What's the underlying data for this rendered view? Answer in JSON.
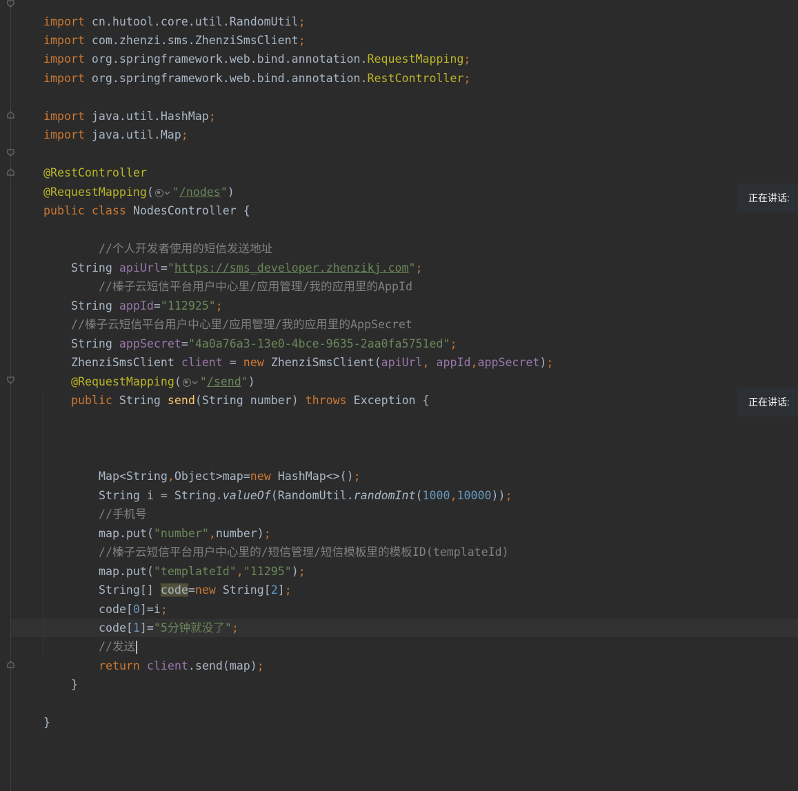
{
  "editor": {
    "lines": {
      "l1": {
        "kw": "import",
        "pkg": " cn.hutool.core.util.RandomUtil",
        "semi": ";"
      },
      "l2": {
        "kw": "import",
        "pkg": " com.zhenzi.sms.ZhenziSmsClient",
        "semi": ";"
      },
      "l3": {
        "kw": "import",
        "pkg": " org.springframework.web.bind.annotation.",
        "cls": "RequestMapping",
        "semi": ";"
      },
      "l4": {
        "kw": "import",
        "pkg": " org.springframework.web.bind.annotation.",
        "cls": "RestController",
        "semi": ";"
      },
      "l6": {
        "kw": "import",
        "pkg": " java.util.HashMap",
        "semi": ";"
      },
      "l7": {
        "kw": "import",
        "pkg": " java.util.Map",
        "semi": ";"
      },
      "l9": {
        "ann": "@RestController"
      },
      "l10": {
        "ann": "@RequestMapping",
        "open": "(",
        "q1": "\"",
        "path": "/nodes",
        "q2": "\"",
        "close": ")"
      },
      "l11": {
        "kw": "public class",
        "name": " NodesController {"
      },
      "l13": {
        "comment": "//个人开发者使用的短信发送地址"
      },
      "l14": {
        "type": "String ",
        "field": "apiUrl",
        "eq": "=",
        "q1": "\"",
        "url": "https://sms_developer.zhenzikj.com",
        "q2": "\"",
        "semi": ";"
      },
      "l15": {
        "comment": "//榛子云短信平台用户中心里/应用管理/我的应用里的AppId"
      },
      "l16": {
        "type": "String ",
        "field": "appId",
        "eq": "=",
        "str": "\"112925\"",
        "semi": ";"
      },
      "l17": {
        "comment": "//榛子云短信平台用户中心里/应用管理/我的应用里的AppSecret"
      },
      "l18": {
        "type": "String ",
        "field": "appSecret",
        "eq": "=",
        "str": "\"4a0a76a3-13e0-4bce-9635-2aa0fa5751ed\"",
        "semi": ";"
      },
      "l19": {
        "type": "ZhenziSmsClient ",
        "field": "client",
        "eq": " = ",
        "kw": "new",
        "ctor": " ZhenziSmsClient(",
        "a1": "apiUrl",
        "c1": ", ",
        "a2": "appId",
        "c2": ",",
        "a3": "appSecret",
        "close": ")",
        "semi": ";"
      },
      "l20": {
        "ann": "@RequestMapping",
        "open": "(",
        "q1": "\"",
        "path": "/send",
        "q2": "\"",
        "close": ")"
      },
      "l21": {
        "kw": "public",
        "type": " String ",
        "method": "send",
        "params": "(String number) ",
        "kw2": "throws",
        "rest": " Exception {"
      },
      "l25": {
        "type": "Map<String",
        "comma": ",",
        "type2": "Object>map=",
        "kw": "new",
        "rest": " HashMap<>()",
        "semi": ";"
      },
      "l26": {
        "pre": "String i = String.",
        "m1": "valueOf",
        "mid": "(RandomUtil.",
        "m2": "randomInt",
        "open": "(",
        "n1": "1000",
        "comma": ",",
        "n2": "10000",
        "close": "))",
        "semi": ";"
      },
      "l27": {
        "comment": "//手机号"
      },
      "l28": {
        "pre": "map.put(",
        "str": "\"number\"",
        "comma": ",",
        "rest": "number)",
        "semi": ";"
      },
      "l29": {
        "comment": "//榛子云短信平台用户中心里的/短信管理/短信模板里的模板ID(templateId)"
      },
      "l30": {
        "pre": "map.put(",
        "str1": "\"templateId\"",
        "comma": ",",
        "str2": "\"11295\"",
        "close": ")",
        "semi": ";"
      },
      "l31": {
        "pre": "String[] ",
        "var": "code",
        "eq": "=",
        "kw": "new",
        "mid": " String[",
        "num": "2",
        "close": "]",
        "semi": ";"
      },
      "l32": {
        "pre": "code[",
        "num": "0",
        "rest": "]=i",
        "semi": ";"
      },
      "l33": {
        "pre": "code[",
        "num": "1",
        "rest": "]=",
        "str": "\"5分钟就没了\"",
        "semi": ";"
      },
      "l34": {
        "comment": "//发送"
      },
      "l35": {
        "kw": "return",
        "sp": " ",
        "field": "client",
        "rest": ".send(map)",
        "semi": ";"
      },
      "l36": {
        "text": "}"
      },
      "l38": {
        "text": "}"
      }
    }
  },
  "overlay": {
    "speaking_label_1": "正在讲话:",
    "speaking_label_2": "正在讲话:"
  }
}
